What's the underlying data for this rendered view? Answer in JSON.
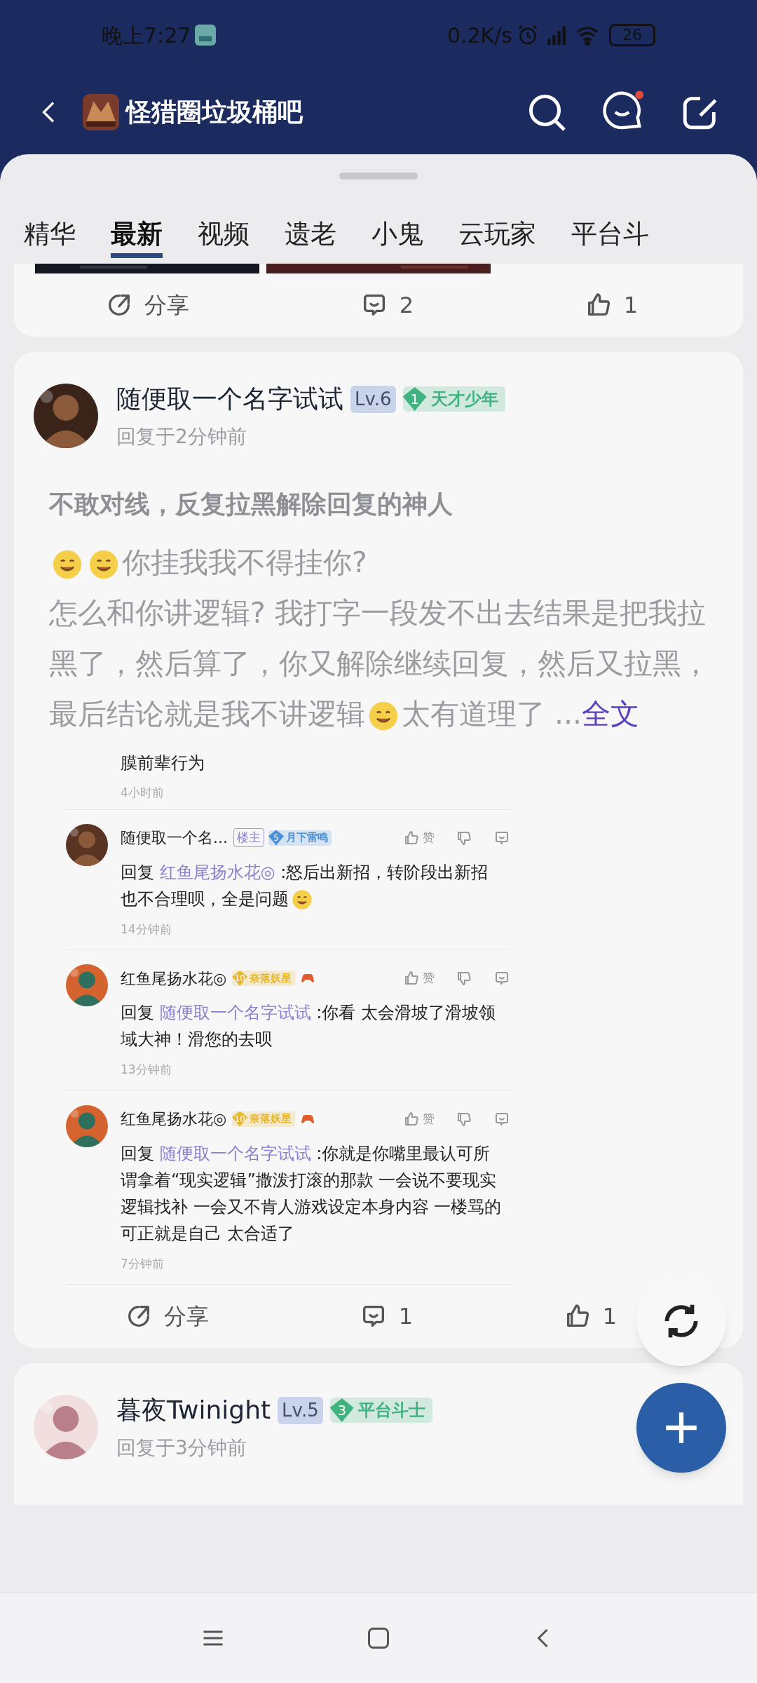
{
  "status_bar": {
    "time": "晚上7:27",
    "speed": "0.2K/s",
    "battery": "26"
  },
  "header": {
    "title": "怪猎圈垃圾桶吧"
  },
  "tabs": [
    {
      "label": "精华",
      "selected": false
    },
    {
      "label": "最新",
      "selected": true
    },
    {
      "label": "视频",
      "selected": false
    },
    {
      "label": "遗老",
      "selected": false
    },
    {
      "label": "小鬼",
      "selected": false
    },
    {
      "label": "云玩家",
      "selected": false
    },
    {
      "label": "平台斗",
      "selected": false
    }
  ],
  "prev_post": {
    "share": "分享",
    "comments": "2",
    "likes": "1"
  },
  "post": {
    "author": "随便取一个名字试试",
    "level": "Lv.6",
    "badge": {
      "num": "1",
      "text": "天才少年"
    },
    "time": "回复于2分钟前",
    "title": "不敢对线，反复拉黑解除回复的神人",
    "paragraphs": [
      [
        {
          "kind": "emoji"
        },
        {
          "kind": "emoji"
        },
        {
          "kind": "text",
          "text": "你挂我我不得挂你?"
        }
      ],
      [
        {
          "kind": "text",
          "text": "怎么和你讲逻辑? 我打字一段发不出去结果是把我拉黑了，然后算了，你又解除继续回复，然后又拉黑，最后结论就是我不讲逻辑"
        },
        {
          "kind": "emoji"
        },
        {
          "kind": "text",
          "text": "太有道理了 ..."
        },
        {
          "kind": "link",
          "text": "全文"
        }
      ]
    ],
    "screenshot": {
      "lead_text": "膜前辈行为",
      "lead_time": "4小时前",
      "comments": [
        {
          "name": "随便取一个名...",
          "tags": [
            {
              "kind": "op",
              "text": "楼主"
            },
            {
              "kind": "medal",
              "num": "5",
              "text": "月下雷鸣",
              "color": "#4a90d9"
            }
          ],
          "reply_label": "回复",
          "reply_to": "红鱼尾扬水花◎",
          "text": ":怒后出新招，转阶段出新招也不合理呗，全是问题",
          "emoji": true,
          "time": "14分钟前",
          "like": "赞"
        },
        {
          "name": "红鱼尾扬水花◎",
          "tags": [
            {
              "kind": "medal",
              "num": "10",
              "text": "奈落妖星",
              "color": "#e8b730"
            },
            {
              "kind": "gamepad"
            }
          ],
          "reply_label": "回复",
          "reply_to": "随便取一个名字试试",
          "text": ":你看 太会滑坡了滑坡领域大神！滑您的去呗",
          "emoji": false,
          "time": "13分钟前",
          "like": "赞"
        },
        {
          "name": "红鱼尾扬水花◎",
          "tags": [
            {
              "kind": "medal",
              "num": "10",
              "text": "奈落妖星",
              "color": "#e8b730"
            },
            {
              "kind": "gamepad"
            }
          ],
          "reply_label": "回复",
          "reply_to": "随便取一个名字试试",
          "text": ":你就是你嘴里最认可所谓拿着“现实逻辑”撒泼打滚的那款 一会说不要现实逻辑找补 一会又不肯人游戏设定本身内容 一楼骂的可正就是自己 太合适了",
          "emoji": false,
          "time": "7分钟前",
          "like": "赞"
        }
      ]
    },
    "share": "分享",
    "comments": "1",
    "likes": "1"
  },
  "next_post": {
    "author": "暮夜Twinight",
    "level": "Lv.5",
    "badge": {
      "num": "3",
      "text": "平台斗士"
    },
    "time": "回复于3分钟前"
  }
}
